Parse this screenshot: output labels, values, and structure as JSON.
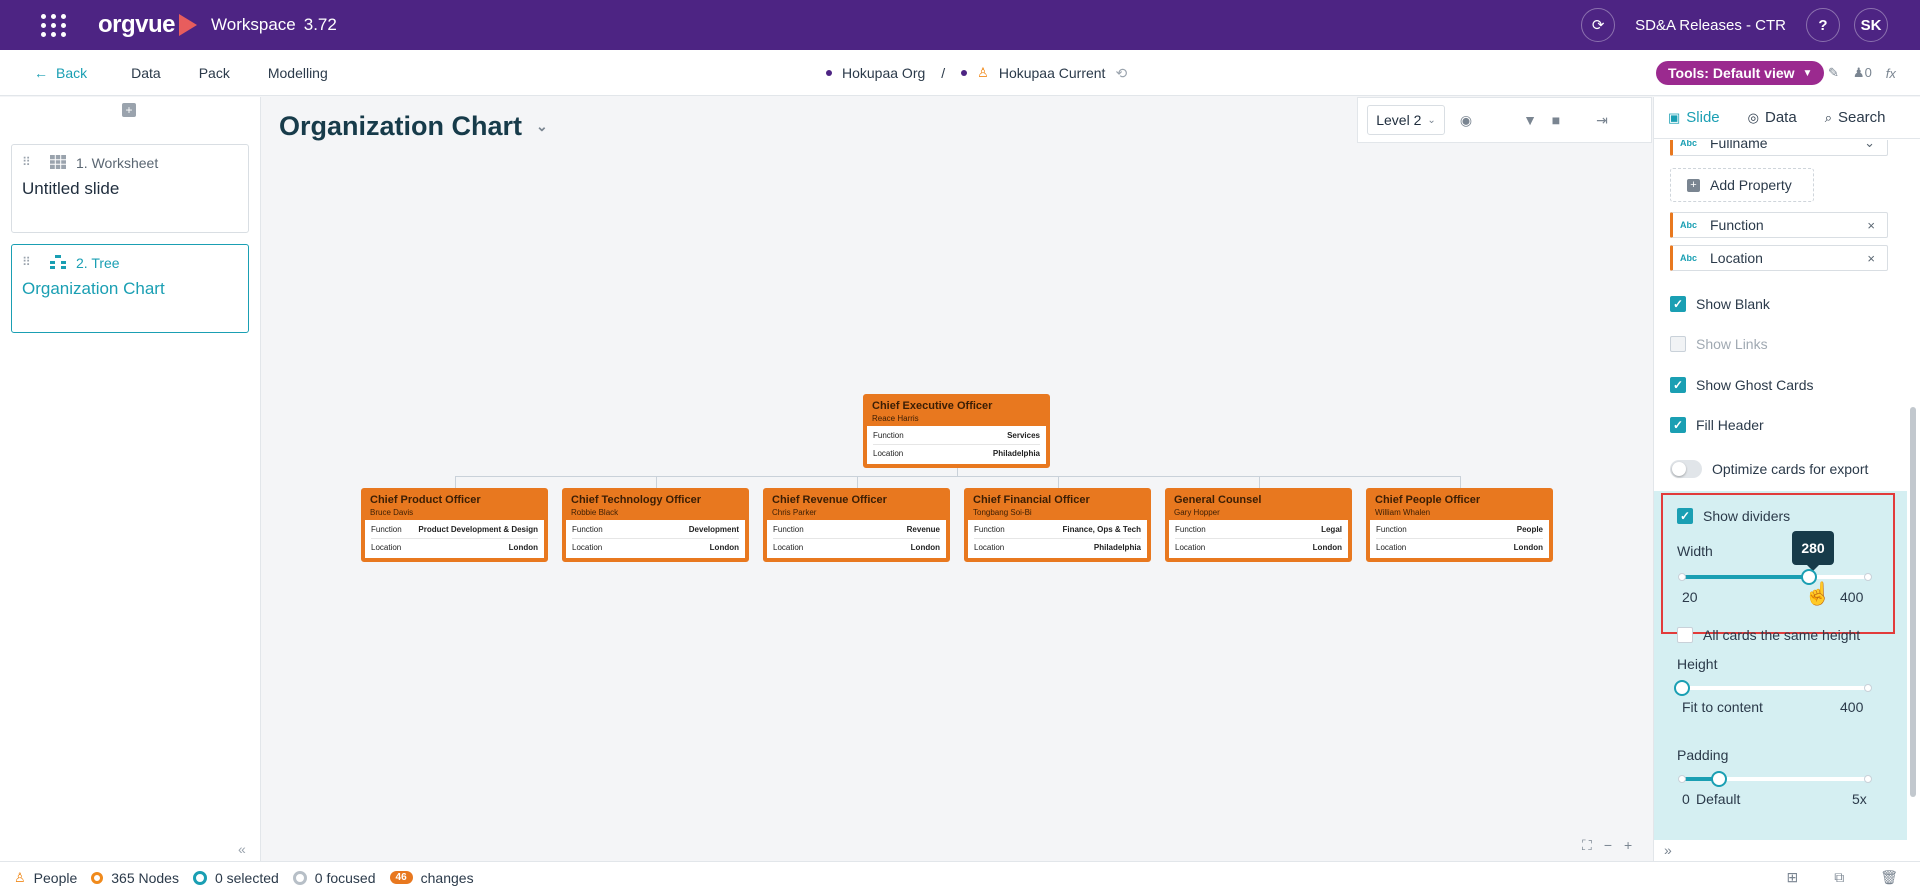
{
  "topbar": {
    "brand": "orgvue",
    "workspace_label": "Workspace",
    "version": "3.72",
    "release": "SD&A Releases - CTR",
    "help_label": "?",
    "user_initials": "SK"
  },
  "subnav": {
    "back_label": "Back",
    "links": [
      "Data",
      "Pack",
      "Modelling"
    ],
    "org_name": "Hokupaa Org",
    "separator": "/",
    "dataset_name": "Hokupaa Current",
    "tools_label": "Tools: Default view",
    "alert_count": "0",
    "fx_label": "fx"
  },
  "slides": [
    {
      "type_label": "1. Worksheet",
      "title": "Untitled slide"
    },
    {
      "type_label": "2. Tree",
      "title": "Organization Chart"
    }
  ],
  "canvas": {
    "title": "Organization Chart",
    "level": "Level 2"
  },
  "org_chart": {
    "field_labels": [
      "Function",
      "Location"
    ],
    "root": {
      "title": "Chief Executive Officer",
      "name": "Reace Harris",
      "function": "Services",
      "location": "Philadelphia"
    },
    "children": [
      {
        "title": "Chief Product Officer",
        "name": "Bruce Davis",
        "function": "Product Development & Design",
        "location": "London"
      },
      {
        "title": "Chief Technology Officer",
        "name": "Robbie Black",
        "function": "Development",
        "location": "London"
      },
      {
        "title": "Chief Revenue Officer",
        "name": "Chris Parker",
        "function": "Revenue",
        "location": "London"
      },
      {
        "title": "Chief Financial Officer",
        "name": "Tongbang Soi-Bi",
        "function": "Finance, Ops & Tech",
        "location": "Philadelphia"
      },
      {
        "title": "General Counsel",
        "name": "Gary Hopper",
        "function": "Legal",
        "location": "London"
      },
      {
        "title": "Chief People Officer",
        "name": "William Whalen",
        "function": "People",
        "location": "London"
      }
    ]
  },
  "right_panel": {
    "tabs": [
      "Slide",
      "Data",
      "Search"
    ],
    "fullname_label": "Fullname",
    "abc_label": "Abc",
    "add_property_label": "Add Property",
    "properties": [
      "Function",
      "Location"
    ],
    "remove_label": "×",
    "options": [
      {
        "label": "Show Blank",
        "checked": true,
        "disabled": false
      },
      {
        "label": "Show Links",
        "checked": false,
        "disabled": true
      },
      {
        "label": "Show Ghost Cards",
        "checked": true,
        "disabled": false
      },
      {
        "label": "Fill Header",
        "checked": true,
        "disabled": false
      }
    ],
    "optimize_label": "Optimize cards for export",
    "show_dividers_label": "Show dividers",
    "width": {
      "label": "Width",
      "value": "280",
      "min": "20",
      "max": "400",
      "fraction": 0.684
    },
    "same_height_label": "All cards the same height",
    "height": {
      "label": "Height",
      "min_label": "Fit to content",
      "max": "400",
      "fraction": 0.0
    },
    "padding": {
      "label": "Padding",
      "min": "0",
      "default_label": "Default",
      "max": "5x",
      "fraction": 0.2
    }
  },
  "statusbar": {
    "people_label": "People",
    "nodes_label": "365 Nodes",
    "selected_label": "0 selected",
    "focused_label": "0 focused",
    "changes_count": "46",
    "changes_label": "changes"
  },
  "colors": {
    "brand_purple": "#4d2483",
    "accent_teal": "#1a9fb3",
    "card_orange": "#e8781f",
    "tools_magenta": "#9b2a8f",
    "highlight_red": "#e23b3b"
  }
}
